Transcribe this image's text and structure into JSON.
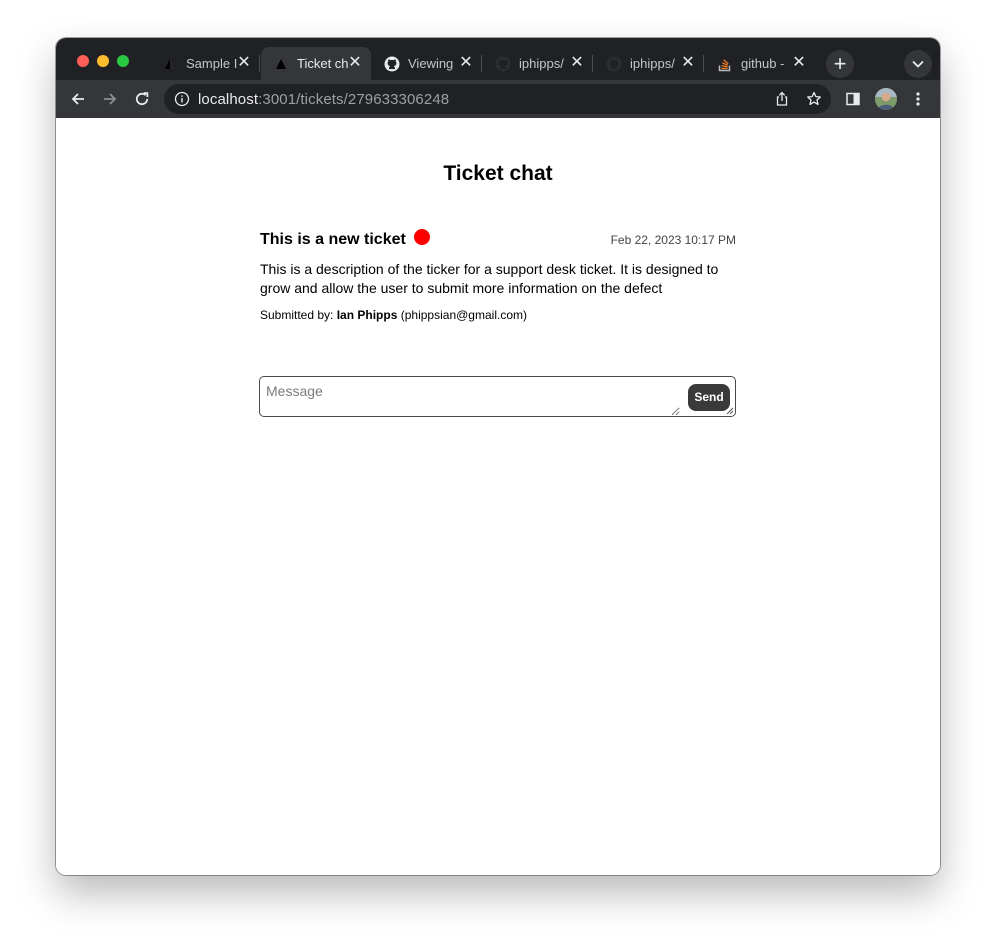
{
  "browser": {
    "tabs": [
      {
        "title": "Sample I",
        "favicon": "vercel-triangle-icon",
        "active": false
      },
      {
        "title": "Ticket ch",
        "favicon": "vercel-triangle-icon",
        "active": true
      },
      {
        "title": "Viewing",
        "favicon": "github-icon",
        "active": false
      },
      {
        "title": "iphipps/",
        "favicon": "github-icon",
        "active": false
      },
      {
        "title": "iphipps/",
        "favicon": "github-icon",
        "active": false
      },
      {
        "title": "github -",
        "favicon": "stackoverflow-icon",
        "active": false
      }
    ],
    "close_glyph": "✕",
    "new_tab_glyph": "+",
    "url": {
      "host": "localhost",
      "rest": ":3001/tickets/279633306248"
    }
  },
  "page": {
    "title": "Ticket chat"
  },
  "ticket": {
    "title": "This is a new ticket",
    "status_color": "#ff0000",
    "date": "Feb 22, 2023 10:17 PM",
    "description": "This is a description of the ticker for a support desk ticket. It is designed to grow and allow the user to submit more information on the defect",
    "submitted_label": "Submitted by:",
    "submitter_name": "Ian Phipps",
    "submitter_email": "(phippsian@gmail.com)"
  },
  "message": {
    "placeholder": "Message",
    "value": "",
    "send_label": "Send"
  }
}
